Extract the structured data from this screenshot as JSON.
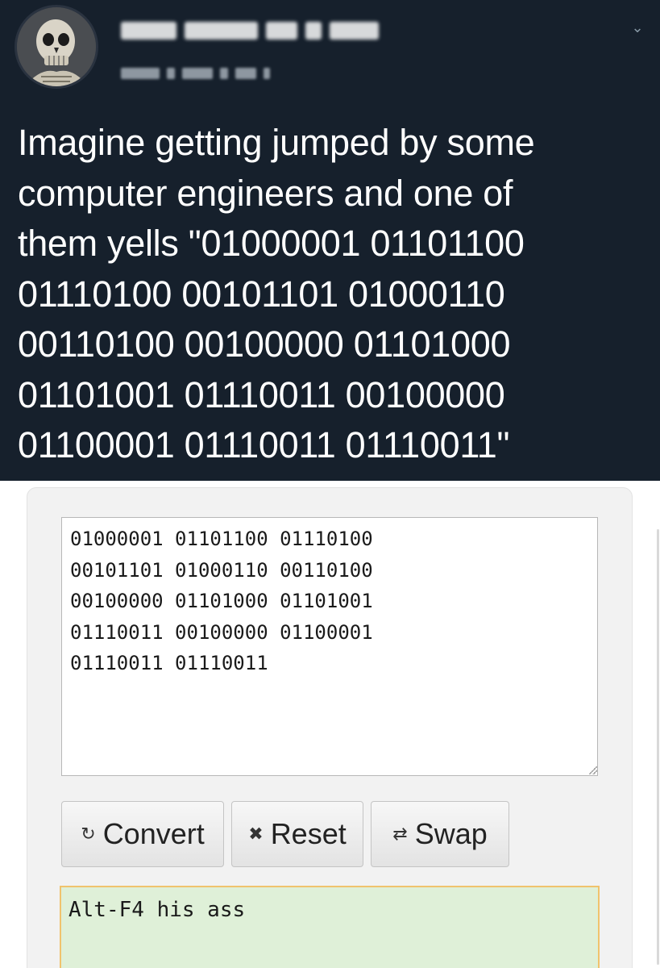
{
  "tweet": {
    "author_name": "",
    "author_handle": "",
    "text": "Imagine getting jumped by some\ncomputer engineers and one of\nthem yells \"01000001 01101100\n01110100 00101101 01000110\n00110100 00100000 01101000\n01101001 01110011 00100000\n01100001 01110011 01110011\""
  },
  "converter": {
    "input_value": "01000001 01101100 01110100\n00101101 01000110 00110100\n00100000 01101000 01101001\n01110011 00100000 01100001\n01110011 01110011",
    "buttons": {
      "convert_icon": "↻",
      "convert_label": "Convert",
      "reset_icon": "✖",
      "reset_label": "Reset",
      "swap_icon": "⇄",
      "swap_label": "Swap"
    },
    "output_value": "Alt-F4 his ass"
  },
  "icons": {
    "chevron": "⌄"
  },
  "colors": {
    "tweet_background": "#16202c",
    "output_background": "#dff0d8",
    "output_border": "#f0c36d"
  }
}
